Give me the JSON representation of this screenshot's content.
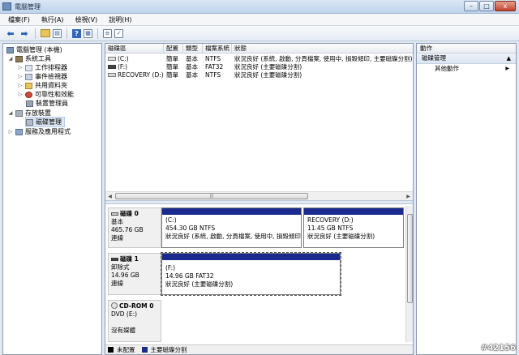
{
  "window": {
    "title": "電腦管理",
    "buttons": [
      "–",
      "□",
      "x"
    ]
  },
  "menu": [
    "檔案(F)",
    "執行(A)",
    "檢視(V)",
    "說明(H)"
  ],
  "tree": {
    "root": "電腦管理 (本機)",
    "system_tools": "系統工具",
    "task_scheduler": "工作排程器",
    "event_viewer": "事件檢視器",
    "shared_folders": "共用資料夾",
    "reliability": "可靠性和效能",
    "device_manager": "裝置管理員",
    "storage": "存放裝置",
    "disk_management": "磁碟管理",
    "services": "服務及應用程式"
  },
  "volume_table": {
    "headers": [
      "磁碟區",
      "配置",
      "類型",
      "檔案系統",
      "狀態"
    ],
    "rows": [
      [
        "(C:)",
        "簡單",
        "基本",
        "NTFS",
        "狀況良好 (系統, 啟動, 分頁檔案, 使用中, 損毀傾印, 主要磁碟分割)"
      ],
      [
        "(F:)",
        "簡單",
        "基本",
        "FAT32",
        "狀況良好 (主要磁碟分割)"
      ],
      [
        "RECOVERY (D:)",
        "簡單",
        "基本",
        "NTFS",
        "狀況良好 (主要磁碟分割)"
      ]
    ]
  },
  "disks": [
    {
      "name": "磁碟 0",
      "type": "基本",
      "size": "465.76 GB",
      "status": "連線",
      "partitions": [
        {
          "label": "(C:)",
          "size": "454.30 GB NTFS",
          "status": "狀況良好 (系統, 啟動, 分頁檔案, 使用中, 損毀傾印"
        },
        {
          "label": "RECOVERY  (D:)",
          "size": "11.45 GB NTFS",
          "status": "狀況良好 (主要磁碟分割)"
        }
      ]
    },
    {
      "name": "磁碟 1",
      "type": "卸除式",
      "size": "14.96 GB",
      "status": "連線",
      "partitions": [
        {
          "label": "(F:)",
          "size": "14.96 GB FAT32",
          "status": "狀況良好 (主要磁碟分割)"
        }
      ]
    },
    {
      "name": "CD-ROM 0",
      "type": "DVD (E:)",
      "size": "",
      "status": "沒有媒體"
    }
  ],
  "legend": {
    "unallocated": "未配置",
    "primary": "主要磁碟分割",
    "colors": {
      "unallocated": "#000000",
      "primary": "#1b2a8e"
    }
  },
  "actions": {
    "header": "動作",
    "section": "磁碟管理",
    "item": "其他動作"
  },
  "watermark": "#42156"
}
